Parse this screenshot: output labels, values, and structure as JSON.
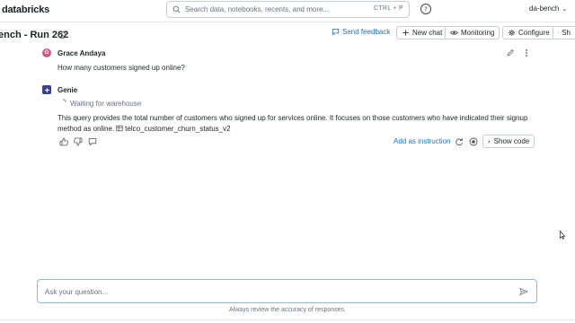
{
  "topbar": {
    "logo_text": "databricks",
    "search_placeholder": "Search data, notebooks, recents, and more...",
    "search_shortcut": "CTRL + P",
    "workspace_name": "da-bench"
  },
  "subbar": {
    "page_title": "ench - Run 262",
    "send_feedback": "Send feedback",
    "new_chat": "New chat",
    "monitoring": "Monitoring",
    "configure": "Configure",
    "share": "Sh"
  },
  "conversation": {
    "user_message": {
      "author": "Grace Andaya",
      "avatar_initial": "G",
      "text": "How many customers signed up online?"
    },
    "assistant_message": {
      "author": "Genie",
      "status": "Waiting for warehouse",
      "text": "This query provides the total number of customers who signed up for services online. It focuses on those customers who have indicated their signup method as online.",
      "table_ref": "telco_customer_churn_status_v2",
      "add_instruction": "Add as instruction",
      "show_code": "Show code"
    }
  },
  "composer": {
    "placeholder": "Ask your question...",
    "disclaimer": "Always review the accuracy of responses."
  },
  "colors": {
    "accent": "#2272b4",
    "user_avatar": "#c85a8a",
    "genie_avatar": "#3b3f8f"
  }
}
